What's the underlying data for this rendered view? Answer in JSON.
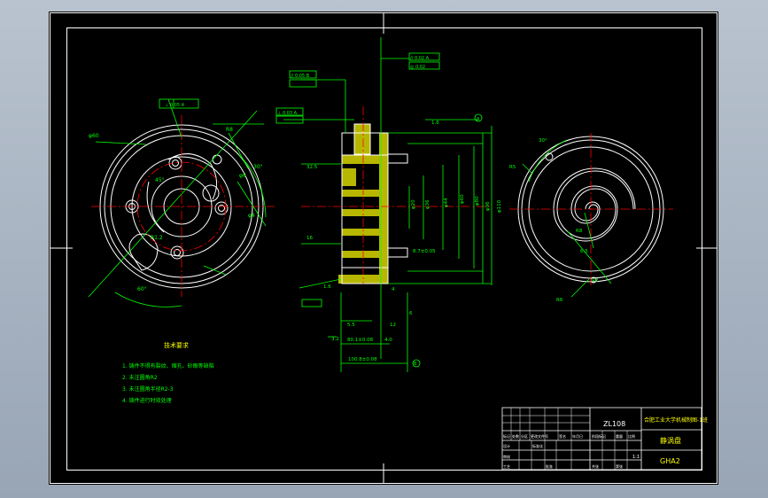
{
  "colors": {
    "background_frame": "#a9b4c2",
    "sheet": "#000000",
    "border": "#ffffff",
    "dimension": "#00ff00",
    "centerline": "#ff0000",
    "tolerance_frame": "#00ff00",
    "highlight": "#ffff00",
    "section_fill": "#ffff00"
  },
  "title_block": {
    "material": "ZL108",
    "school": "合肥工业大学机械制图-1班",
    "part_name": "静涡盘",
    "drawing_number": "GHA2",
    "scale": "1:1",
    "header_cells": [
      "标记",
      "处数",
      "分区",
      "更改文件号",
      "签名",
      "年月日"
    ],
    "design_cells": [
      "设计",
      "标准化",
      "阶段标记",
      "重量",
      "比例"
    ],
    "review_cells": [
      "审核",
      "工艺",
      "批准",
      "共张",
      "第张"
    ]
  },
  "technical_requirements": {
    "title": "技术要求",
    "items": [
      "1. 铸件不得有裂纹、缩孔、砂眼等缺陷",
      "2. 未注圆角R2",
      "3. 未注圆角半径R2-3",
      "4. 铸件进行时效处理"
    ]
  },
  "front_view": {
    "labels": [
      "φ60",
      "R8",
      "φ6",
      "φ4",
      "30°",
      "60°",
      "R1.2",
      "45°"
    ],
    "tolerance": "⊥ 0.05 A"
  },
  "section_view": {
    "labels": [
      "1.6",
      "A",
      "φ110",
      "φ96",
      "φ80",
      "φ60",
      "φ44",
      "φ36",
      "φ20",
      "32.5",
      "16",
      "4",
      "5.5",
      "12",
      "6",
      "3.2",
      "1.6",
      "B",
      "100.8±0.08",
      "80.1±0.08",
      "4.0",
      "8.7±0.05"
    ],
    "tolerances": [
      "// 0.02 A",
      "◎ 0.02",
      "// 0.05 B",
      "⊥ 0.03 A"
    ]
  },
  "right_view": {
    "labels": [
      "R5",
      "R8",
      "6.5",
      "R2",
      "30°",
      "R6"
    ]
  }
}
